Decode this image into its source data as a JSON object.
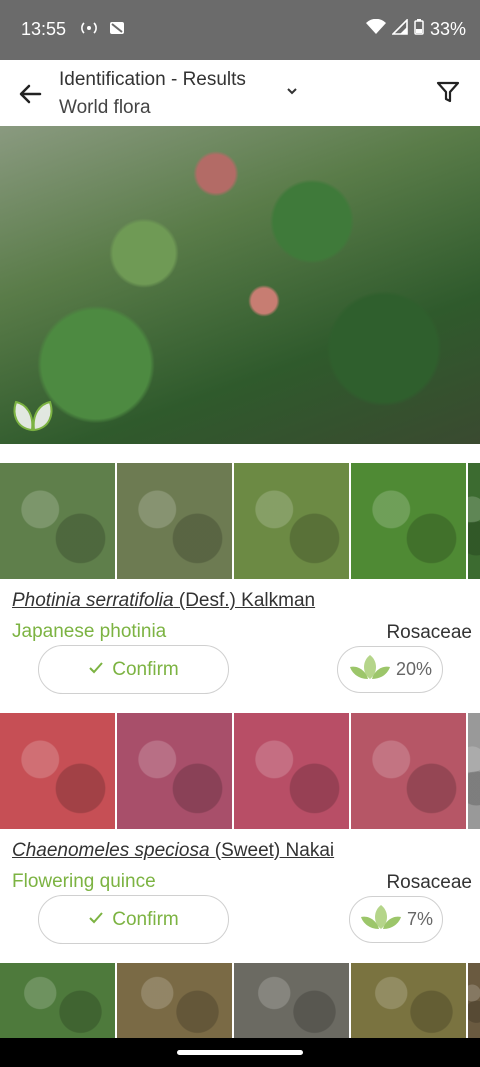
{
  "status": {
    "time": "13:55",
    "battery": "33%",
    "icons": [
      "radio-icon",
      "no-sim-icon",
      "wifi-icon",
      "signal-icon",
      "battery-icon"
    ]
  },
  "header": {
    "title": "Identification - Results",
    "subtitle": "World flora"
  },
  "results": [
    {
      "sci_name": "Photinia serratifolia",
      "author": "(Desf.) Kalkman",
      "common": "Japanese photinia",
      "family": "Rosaceae",
      "confirm_label": "Confirm",
      "score": "20%",
      "thumb_colors": [
        "#5f7f4b",
        "#6d7b52",
        "#6c8a44",
        "#4f8a34",
        "#3c6b30"
      ]
    },
    {
      "sci_name": "Chaenomeles speciosa",
      "author": "(Sweet) Nakai",
      "common": "Flowering quince",
      "family": "Rosaceae",
      "confirm_label": "Confirm",
      "score": "7%",
      "thumb_colors": [
        "#c64f55",
        "#a84f6a",
        "#b84e66",
        "#b65666",
        "#999999"
      ]
    },
    {
      "thumb_colors": [
        "#4e7a3c",
        "#7a6a45",
        "#6b6a62",
        "#7a7340",
        "#6a5a40"
      ]
    }
  ],
  "colors": {
    "accent": "#7cb342"
  }
}
